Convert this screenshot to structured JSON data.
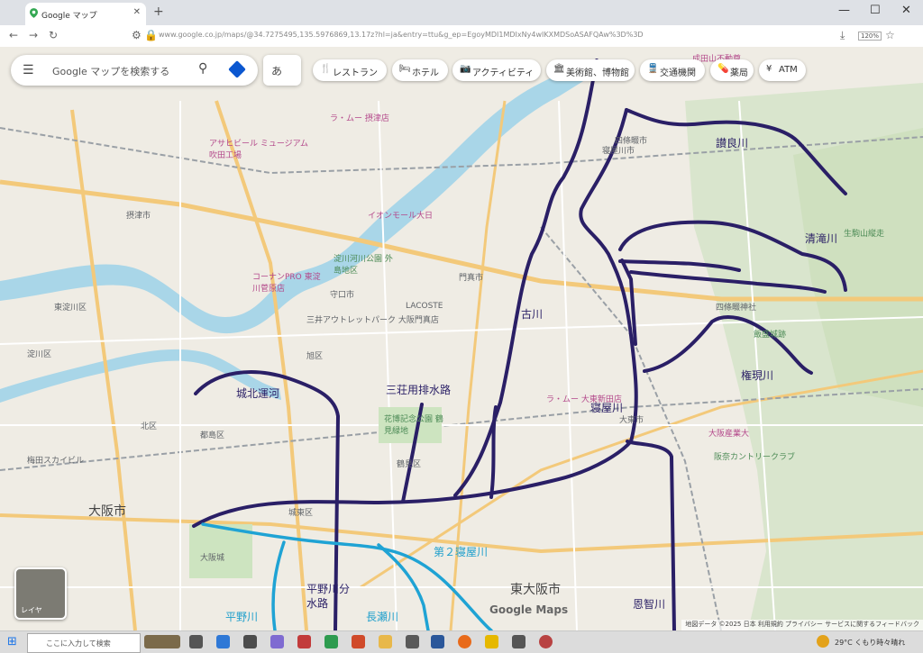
{
  "browser": {
    "tab_title": "Google マップ",
    "new_tab": "+",
    "url": "www.google.co.jp/maps/@34.7275495,135.5976869,13.17z?hl=ja&entry=ttu&g_ep=EgoyMDI1MDIxNy4wIKXMDSoASAFQAw%3D%3D",
    "zoom": "120%"
  },
  "search": {
    "placeholder": "Google マップを検索する",
    "ime": "あ"
  },
  "chips": [
    {
      "icon": "fork-knife-icon",
      "label": "レストラン"
    },
    {
      "icon": "bed-icon",
      "label": "ホテル"
    },
    {
      "icon": "camera-icon",
      "label": "アクティビティ"
    },
    {
      "icon": "museum-icon",
      "label": "美術館、博物館"
    },
    {
      "icon": "train-icon",
      "label": "交通機関"
    },
    {
      "icon": "pill-icon",
      "label": "薬局"
    },
    {
      "icon": "atm-icon",
      "label": "ATM"
    }
  ],
  "rivers": {
    "shiroKita": "城北運河",
    "sanso": "三荘用排水路",
    "furu": "古川",
    "sanagara": "讃良川",
    "seitaki": "清滝川",
    "gongen": "権現川",
    "neyagawa": "寝屋川",
    "onji": "恩智川",
    "neyagawa2": "第２寝屋川",
    "hiranoBunsui": "平野川分水路",
    "hirano": "平野川",
    "nagase": "長瀬川"
  },
  "places": {
    "osaka_city": "大阪市",
    "higashiosaka": "東大阪市",
    "daito": "大東市",
    "shijonawate": "四條畷市",
    "kadoma": "門真市",
    "moriguchi": "守口市",
    "settsu": "摂津市",
    "neyagawa_city": "寝屋川市",
    "osaka_castle": "大阪城",
    "umeda_sky": "梅田スカイビル",
    "asahi_beer": "アサヒビール ミュージアム 吹田工場",
    "lacoste": "LACOSTE",
    "mitsui_outlet": "三井アウトレットパーク 大阪門真店",
    "yodogawa_park": "淀川河川公園 外島地区",
    "konan_pro": "コーナンPRO 東淀川菅原店",
    "aeon": "イオンモール大日",
    "ramu1": "ラ・ムー 摂津店",
    "ramu2": "ラ・ムー 大東新田店",
    "shijo_shrine": "四條畷神社",
    "iimori": "飯盛城跡",
    "hanshin_cc": "阪奈カントリークラブ",
    "hanaten": "花博記念公園 鶴見緑地",
    "jonan": "城東区",
    "tsurumi": "鶴見区",
    "asahi": "旭区",
    "miyakojima": "都島区",
    "kita": "北区",
    "yodogawa_ward": "淀川区",
    "higashiyodogawa": "東淀川区",
    "osaka_univ_ind": "大阪産業大",
    "hanaokasan": "生駒山縦走",
    "narita": "成田山不動尊"
  },
  "layer_label": "レイヤ",
  "google_logo": "Google Maps",
  "attribution": "地図データ ©2025 日本 利用規約 プライバシー サービスに関するフィードバック",
  "taskbar": {
    "search_placeholder": "ここに入力して検索",
    "weather": "29°C くもり時々晴れ"
  }
}
